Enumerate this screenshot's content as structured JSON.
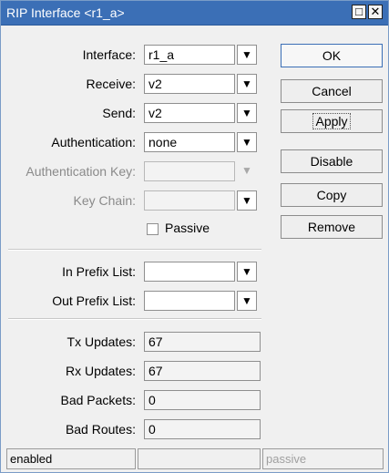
{
  "window": {
    "title": "RIP Interface <r1_a>"
  },
  "form": {
    "interface": {
      "label": "Interface:",
      "value": "r1_a"
    },
    "receive": {
      "label": "Receive:",
      "value": "v2"
    },
    "send": {
      "label": "Send:",
      "value": "v2"
    },
    "authentication": {
      "label": "Authentication:",
      "value": "none"
    },
    "authentication_key": {
      "label": "Authentication Key:",
      "value": ""
    },
    "key_chain": {
      "label": "Key Chain:",
      "value": ""
    },
    "passive": {
      "label": "Passive",
      "checked": false
    },
    "in_prefix_list": {
      "label": "In Prefix List:",
      "value": ""
    },
    "out_prefix_list": {
      "label": "Out Prefix List:",
      "value": ""
    },
    "tx_updates": {
      "label": "Tx Updates:",
      "value": "67"
    },
    "rx_updates": {
      "label": "Rx Updates:",
      "value": "67"
    },
    "bad_packets": {
      "label": "Bad Packets:",
      "value": "0"
    },
    "bad_routes": {
      "label": "Bad Routes:",
      "value": "0"
    }
  },
  "buttons": {
    "ok": "OK",
    "cancel": "Cancel",
    "apply": "Apply",
    "disable": "Disable",
    "copy": "Copy",
    "remove": "Remove"
  },
  "status": {
    "state": "enabled",
    "middle": "",
    "passive": "passive"
  },
  "icons": {
    "dropdown": "dropdown-arrow-icon",
    "maximize": "maximize-icon",
    "close": "close-icon"
  }
}
